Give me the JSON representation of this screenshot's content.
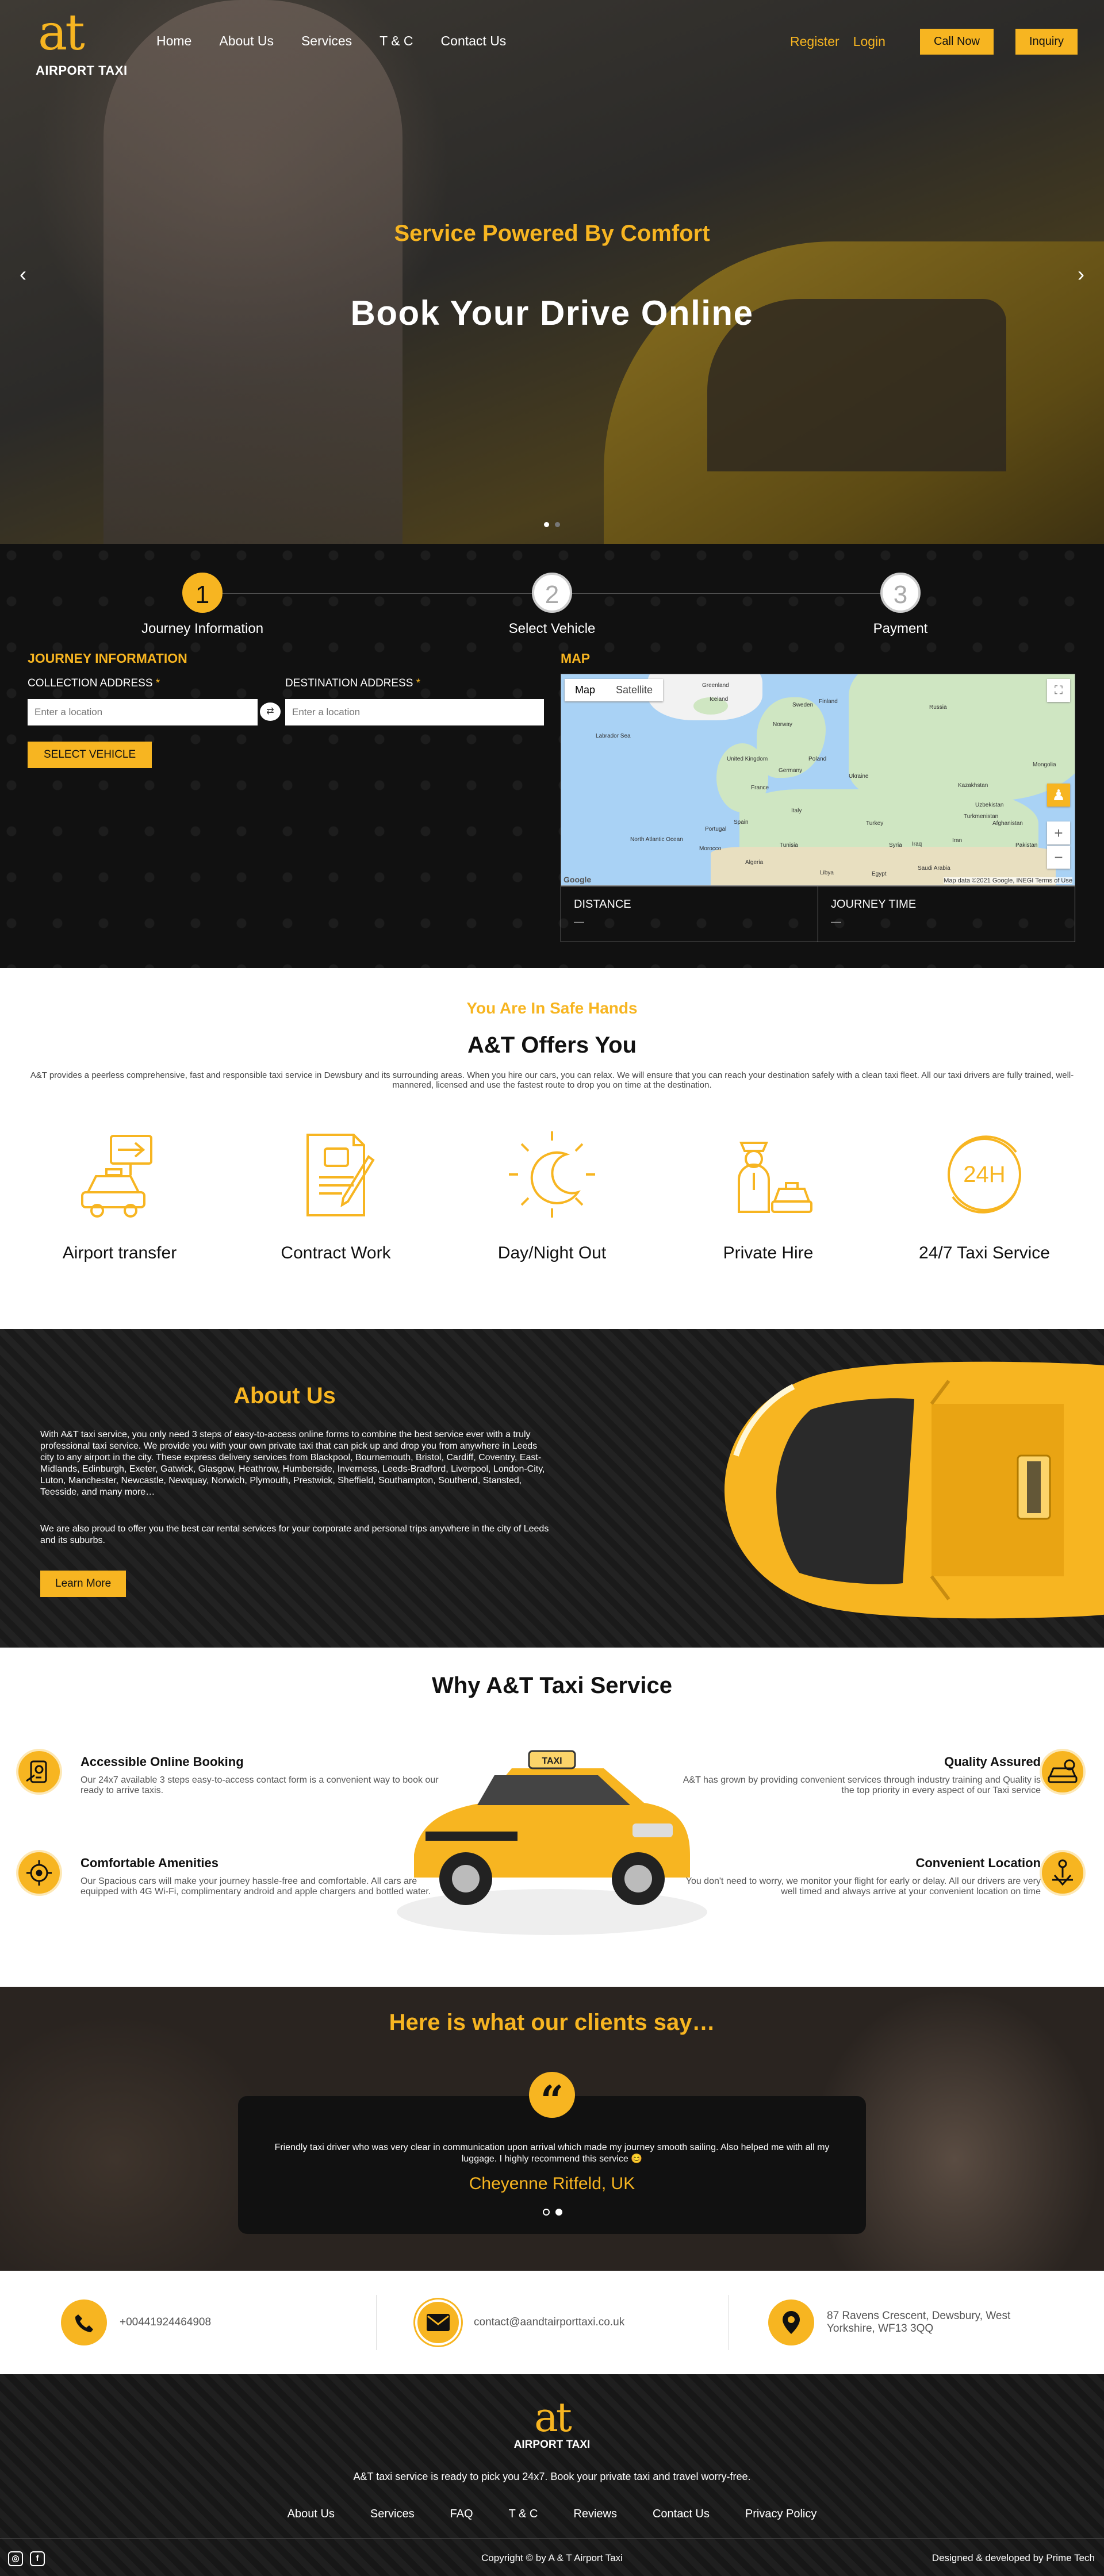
{
  "brand": {
    "mark": "at",
    "name": "AIRPORT TAXI"
  },
  "nav": [
    "Home",
    "About Us",
    "Services",
    "T & C",
    "Contact Us"
  ],
  "top_actions": {
    "register": "Register",
    "login": "Login",
    "call": "Call Now",
    "inquiry": "Inquiry"
  },
  "hero": {
    "subtitle": "Service Powered By Comfort",
    "title": "Book Your Drive Online",
    "prev": "‹",
    "next": "›",
    "slides": 2,
    "active_slide": 1
  },
  "steps": [
    {
      "num": "1",
      "label": "Journey Information",
      "active": true
    },
    {
      "num": "2",
      "label": "Select Vehicle",
      "active": false
    },
    {
      "num": "3",
      "label": "Payment",
      "active": false
    }
  ],
  "journey": {
    "heading": "JOURNEY INFORMATION",
    "collection_label": "COLLECTION ADDRESS",
    "destination_label": "DESTINATION ADDRESS",
    "required": "*",
    "collection_placeholder": "Enter a location",
    "destination_placeholder": "Enter a location",
    "select_button": "SELECT VEHICLE"
  },
  "map": {
    "heading": "MAP",
    "tab_map": "Map",
    "tab_satellite": "Satellite",
    "google": "Google",
    "credit": "Map data ©2021 Google, INEGI   Terms of Use",
    "labels": [
      "Greenland",
      "Iceland",
      "Sweden",
      "Finland",
      "Norway",
      "Russia",
      "United Kingdom",
      "Poland",
      "Germany",
      "France",
      "Ukraine",
      "Kazakhstan",
      "Spain",
      "Italy",
      "Turkey",
      "Iran",
      "Iraq",
      "Afghanistan",
      "Portugal",
      "Tunisia",
      "Algeria",
      "Libya",
      "Egypt",
      "Pakistan",
      "Morocco",
      "North Atlantic Ocean",
      "Labrador Sea",
      "Turkmenistan",
      "Uzbekistan",
      "Syria",
      "Saudi Arabia",
      "Mongolia"
    ]
  },
  "distance": {
    "label": "DISTANCE",
    "value": "—"
  },
  "journey_time": {
    "label": "JOURNEY TIME",
    "value": "—"
  },
  "offers": {
    "kicker": "You Are In Safe Hands",
    "title": "A&T Offers You",
    "text": "A&T provides a peerless comprehensive, fast and responsible taxi service in Dewsbury and its surrounding areas. When you hire our cars, you can relax. We will ensure that you can reach your destination safely with a clean taxi fleet. All our taxi drivers are fully trained, well-mannered, licensed and use the fastest route to drop you on time at the destination.",
    "items": [
      "Airport transfer",
      "Contract Work",
      "Day/Night Out",
      "Private Hire",
      "24/7 Taxi Service"
    ],
    "icon_247": "24H"
  },
  "about": {
    "title": "About Us",
    "para1": "With A&T taxi service, you only need 3 steps of easy-to-access online forms to combine the best service ever with a truly professional taxi service. We provide you with your own private taxi that can pick up and drop you from anywhere in Leeds city to any airport in the city. These express delivery services from Blackpool, Bournemouth, Bristol, Cardiff, Coventry, East-Midlands, Edinburgh, Exeter, Gatwick, Glasgow, Heathrow, Humberside, Inverness, Leeds-Bradford, Liverpool, London-City, Luton, Manchester, Newcastle, Newquay, Norwich, Plymouth, Prestwick, Sheffield, Southampton, Southend, Stansted, Teesside, and many more…",
    "para2": "We are also proud to offer you the best car rental services for your corporate and personal trips anywhere in the city of Leeds and its suburbs.",
    "button": "Learn More"
  },
  "why": {
    "title": "Why A&T Taxi Service",
    "features": [
      {
        "title": "Accessible Online Booking",
        "text": "Our 24x7 available 3 steps easy-to-access contact form is a convenient way to book our ready to arrive taxis."
      },
      {
        "title": "Comfortable Amenities",
        "text": "Our Spacious cars will make your journey hassle-free and comfortable. All cars are equipped with 4G Wi-Fi, complimentary android and apple chargers and bottled water."
      },
      {
        "title": "Quality Assured",
        "text": "A&T has grown by providing convenient services through industry training and Quality is the top priority in every aspect of our Taxi service"
      },
      {
        "title": "Convenient Location",
        "text": "You don't need to worry, we monitor your flight for early or delay. All our drivers are very well timed and always arrive at your convenient location on time"
      }
    ],
    "taxi_sign": "TAXI"
  },
  "testimonial": {
    "title": "Here is what our clients say…",
    "quote_mark": "“",
    "text": "Friendly taxi driver who was very clear in communication upon arrival which made my journey smooth sailing. Also helped me with all my luggage. I highly recommend this service 😊",
    "author": "Cheyenne Ritfeld, UK",
    "slides": 2,
    "active_slide": 2
  },
  "contact": {
    "phone": "+00441924464908",
    "email": "contact@aandtairporttaxi.co.uk",
    "address_line1": "87 Ravens Crescent, Dewsbury, West",
    "address_line2": "Yorkshire, WF13 3QQ"
  },
  "footer": {
    "tagline": "A&T taxi service is ready to pick you 24x7. Book your private taxi and travel worry-free.",
    "links": [
      "About Us",
      "Services",
      "FAQ",
      "T & C",
      "Reviews",
      "Contact Us",
      "Privacy Policy"
    ],
    "social": [
      "instagram-icon",
      "facebook-icon"
    ],
    "instagram_glyph": "◎",
    "facebook_glyph": "f",
    "copyright": "Copyright © by A & T Airport Taxi",
    "designed": "Designed & developed by Prime Tech"
  },
  "colors": {
    "accent": "#f7b521",
    "dark": "#111111"
  }
}
